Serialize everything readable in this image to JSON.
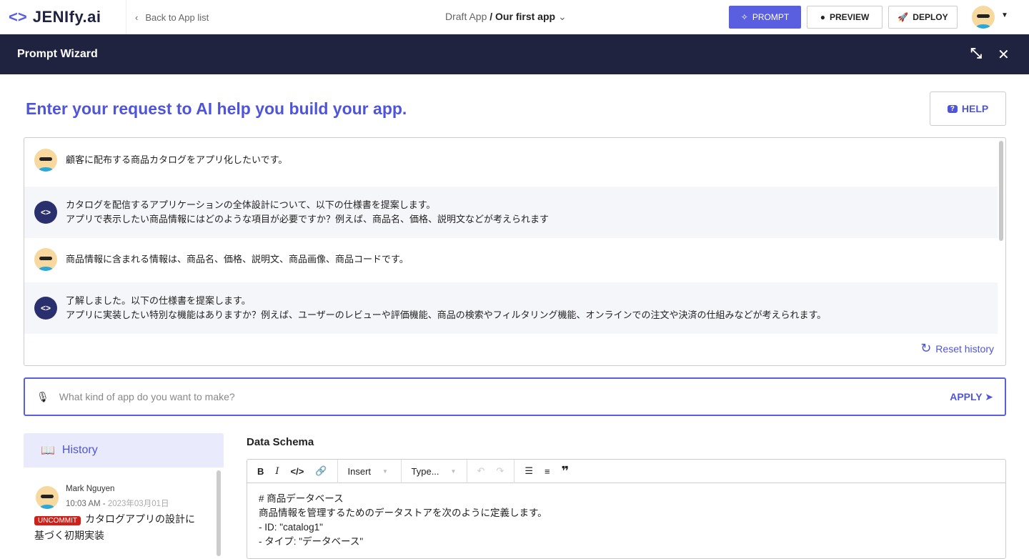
{
  "topbar": {
    "logo": "JENIfy.ai",
    "back": "Back to App list",
    "crumb_parent": "Draft App",
    "crumb_sep": "/",
    "crumb_current": "Our first app",
    "prompt": "PROMPT",
    "preview": "PREVIEW",
    "deploy": "DEPLOY"
  },
  "wizard": {
    "title": "Prompt Wizard",
    "heading": "Enter your request to AI help you build your app.",
    "help": "HELP"
  },
  "chat": {
    "messages": [
      {
        "role": "user",
        "lines": [
          "顧客に配布する商品カタログをアプリ化したいです。"
        ]
      },
      {
        "role": "ai",
        "lines": [
          "カタログを配信するアプリケーションの全体設計について、以下の仕様書を提案します。",
          "アプリで表示したい商品情報にはどのような項目が必要ですか？例えば、商品名、価格、説明文などが考えられます"
        ]
      },
      {
        "role": "user",
        "lines": [
          "商品情報に含まれる情報は、商品名、価格、説明文、商品画像、商品コードです。"
        ]
      },
      {
        "role": "ai",
        "lines": [
          "了解しました。以下の仕様書を提案します。",
          "アプリに実装したい特別な機能はありますか？例えば、ユーザーのレビューや評価機能、商品の検索やフィルタリング機能、オンラインでの注文や決済の仕組みなどが考えられます。"
        ]
      }
    ],
    "reset": "Reset history"
  },
  "prompt": {
    "placeholder": "What kind of app do you want to make?",
    "value": "",
    "apply": "APPLY"
  },
  "history": {
    "title": "History",
    "items": [
      {
        "user": "Mark Nguyen",
        "time": "10:03 AM -",
        "date": "2023年03月01日",
        "badge": "UNCOMMIT",
        "text": "カタログアプリの設計に基づく初期実装"
      }
    ]
  },
  "schema": {
    "title": "Data Schema",
    "toolbar": {
      "insert": "Insert",
      "type": "Type..."
    },
    "lines": [
      "# 商品データベース",
      "商品情報を管理するためのデータストアを次のように定義します。",
      "- ID: \"catalog1\"",
      "- タイプ: \"データベース\""
    ]
  }
}
